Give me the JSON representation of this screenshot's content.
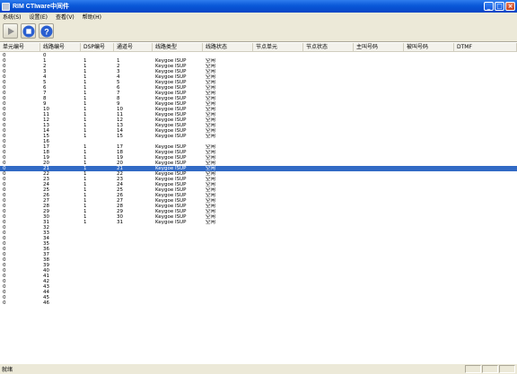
{
  "window": {
    "title": "RIM CTIware中间件"
  },
  "menu": [
    {
      "label": "系统(S)"
    },
    {
      "label": "设置(E)"
    },
    {
      "label": "查看(V)"
    },
    {
      "label": "帮助(H)"
    }
  ],
  "toolbar": [
    {
      "name": "start-button",
      "icon": "play-icon"
    },
    {
      "name": "stop-button",
      "icon": "stop-icon"
    },
    {
      "name": "help-button",
      "icon": "help-icon"
    }
  ],
  "columns": [
    "单元编号",
    "线路编号",
    "DSP编号",
    "通道号",
    "线路类型",
    "线路状态",
    "节点单元",
    "节点状态",
    "主叫号码",
    "被叫号码",
    "DTMF"
  ],
  "rows": [
    [
      "0",
      "0",
      "",
      "",
      "",
      "",
      "",
      "",
      "",
      "",
      ""
    ],
    [
      "0",
      "1",
      "1",
      "1",
      "Keygoe ISUP",
      "空闲",
      "",
      "",
      "",
      "",
      ""
    ],
    [
      "0",
      "2",
      "1",
      "2",
      "Keygoe ISUP",
      "空闲",
      "",
      "",
      "",
      "",
      ""
    ],
    [
      "0",
      "3",
      "1",
      "3",
      "Keygoe ISUP",
      "空闲",
      "",
      "",
      "",
      "",
      ""
    ],
    [
      "0",
      "4",
      "1",
      "4",
      "Keygoe ISUP",
      "空闲",
      "",
      "",
      "",
      "",
      ""
    ],
    [
      "0",
      "5",
      "1",
      "5",
      "Keygoe ISUP",
      "空闲",
      "",
      "",
      "",
      "",
      ""
    ],
    [
      "0",
      "6",
      "1",
      "6",
      "Keygoe ISUP",
      "空闲",
      "",
      "",
      "",
      "",
      ""
    ],
    [
      "0",
      "7",
      "1",
      "7",
      "Keygoe ISUP",
      "空闲",
      "",
      "",
      "",
      "",
      ""
    ],
    [
      "0",
      "8",
      "1",
      "8",
      "Keygoe ISUP",
      "空闲",
      "",
      "",
      "",
      "",
      ""
    ],
    [
      "0",
      "9",
      "1",
      "9",
      "Keygoe ISUP",
      "空闲",
      "",
      "",
      "",
      "",
      ""
    ],
    [
      "0",
      "10",
      "1",
      "10",
      "Keygoe ISUP",
      "空闲",
      "",
      "",
      "",
      "",
      ""
    ],
    [
      "0",
      "11",
      "1",
      "11",
      "Keygoe ISUP",
      "空闲",
      "",
      "",
      "",
      "",
      ""
    ],
    [
      "0",
      "12",
      "1",
      "12",
      "Keygoe ISUP",
      "空闲",
      "",
      "",
      "",
      "",
      ""
    ],
    [
      "0",
      "13",
      "1",
      "13",
      "Keygoe ISUP",
      "空闲",
      "",
      "",
      "",
      "",
      ""
    ],
    [
      "0",
      "14",
      "1",
      "14",
      "Keygoe ISUP",
      "空闲",
      "",
      "",
      "",
      "",
      ""
    ],
    [
      "0",
      "15",
      "1",
      "15",
      "Keygoe ISUP",
      "空闲",
      "",
      "",
      "",
      "",
      ""
    ],
    [
      "0",
      "16",
      "",
      "",
      "",
      "",
      "",
      "",
      "",
      "",
      ""
    ],
    [
      "0",
      "17",
      "1",
      "17",
      "Keygoe ISUP",
      "空闲",
      "",
      "",
      "",
      "",
      ""
    ],
    [
      "0",
      "18",
      "1",
      "18",
      "Keygoe ISUP",
      "空闲",
      "",
      "",
      "",
      "",
      ""
    ],
    [
      "0",
      "19",
      "1",
      "19",
      "Keygoe ISUP",
      "空闲",
      "",
      "",
      "",
      "",
      ""
    ],
    [
      "0",
      "20",
      "1",
      "20",
      "Keygoe ISUP",
      "空闲",
      "",
      "",
      "",
      "",
      ""
    ],
    [
      "0",
      "21",
      "1",
      "21",
      "Keygoe ISUP",
      "空闲",
      "",
      "",
      "",
      "",
      ""
    ],
    [
      "0",
      "22",
      "1",
      "22",
      "Keygoe ISUP",
      "空闲",
      "",
      "",
      "",
      "",
      ""
    ],
    [
      "0",
      "23",
      "1",
      "23",
      "Keygoe ISUP",
      "空闲",
      "",
      "",
      "",
      "",
      ""
    ],
    [
      "0",
      "24",
      "1",
      "24",
      "Keygoe ISUP",
      "空闲",
      "",
      "",
      "",
      "",
      ""
    ],
    [
      "0",
      "25",
      "1",
      "25",
      "Keygoe ISUP",
      "空闲",
      "",
      "",
      "",
      "",
      ""
    ],
    [
      "0",
      "26",
      "1",
      "26",
      "Keygoe ISUP",
      "空闲",
      "",
      "",
      "",
      "",
      ""
    ],
    [
      "0",
      "27",
      "1",
      "27",
      "Keygoe ISUP",
      "空闲",
      "",
      "",
      "",
      "",
      ""
    ],
    [
      "0",
      "28",
      "1",
      "28",
      "Keygoe ISUP",
      "空闲",
      "",
      "",
      "",
      "",
      ""
    ],
    [
      "0",
      "29",
      "1",
      "29",
      "Keygoe ISUP",
      "空闲",
      "",
      "",
      "",
      "",
      ""
    ],
    [
      "0",
      "30",
      "1",
      "30",
      "Keygoe ISUP",
      "空闲",
      "",
      "",
      "",
      "",
      ""
    ],
    [
      "0",
      "31",
      "1",
      "31",
      "Keygoe ISUP",
      "空闲",
      "",
      "",
      "",
      "",
      ""
    ],
    [
      "0",
      "32",
      "",
      "",
      "",
      "",
      "",
      "",
      "",
      "",
      ""
    ],
    [
      "0",
      "33",
      "",
      "",
      "",
      "",
      "",
      "",
      "",
      "",
      ""
    ],
    [
      "0",
      "34",
      "",
      "",
      "",
      "",
      "",
      "",
      "",
      "",
      ""
    ],
    [
      "0",
      "35",
      "",
      "",
      "",
      "",
      "",
      "",
      "",
      "",
      ""
    ],
    [
      "0",
      "36",
      "",
      "",
      "",
      "",
      "",
      "",
      "",
      "",
      ""
    ],
    [
      "0",
      "37",
      "",
      "",
      "",
      "",
      "",
      "",
      "",
      "",
      ""
    ],
    [
      "0",
      "38",
      "",
      "",
      "",
      "",
      "",
      "",
      "",
      "",
      ""
    ],
    [
      "0",
      "39",
      "",
      "",
      "",
      "",
      "",
      "",
      "",
      "",
      ""
    ],
    [
      "0",
      "40",
      "",
      "",
      "",
      "",
      "",
      "",
      "",
      "",
      ""
    ],
    [
      "0",
      "41",
      "",
      "",
      "",
      "",
      "",
      "",
      "",
      "",
      ""
    ],
    [
      "0",
      "42",
      "",
      "",
      "",
      "",
      "",
      "",
      "",
      "",
      ""
    ],
    [
      "0",
      "43",
      "",
      "",
      "",
      "",
      "",
      "",
      "",
      "",
      ""
    ],
    [
      "0",
      "44",
      "",
      "",
      "",
      "",
      "",
      "",
      "",
      "",
      ""
    ],
    [
      "0",
      "45",
      "",
      "",
      "",
      "",
      "",
      "",
      "",
      "",
      ""
    ],
    [
      "0",
      "46",
      "",
      "",
      "",
      "",
      "",
      "",
      "",
      "",
      ""
    ]
  ],
  "selected_row": 21,
  "status": {
    "text": "就绪"
  },
  "colors": {
    "selection": "#316ac5",
    "titlebar": "#0a58d8"
  }
}
